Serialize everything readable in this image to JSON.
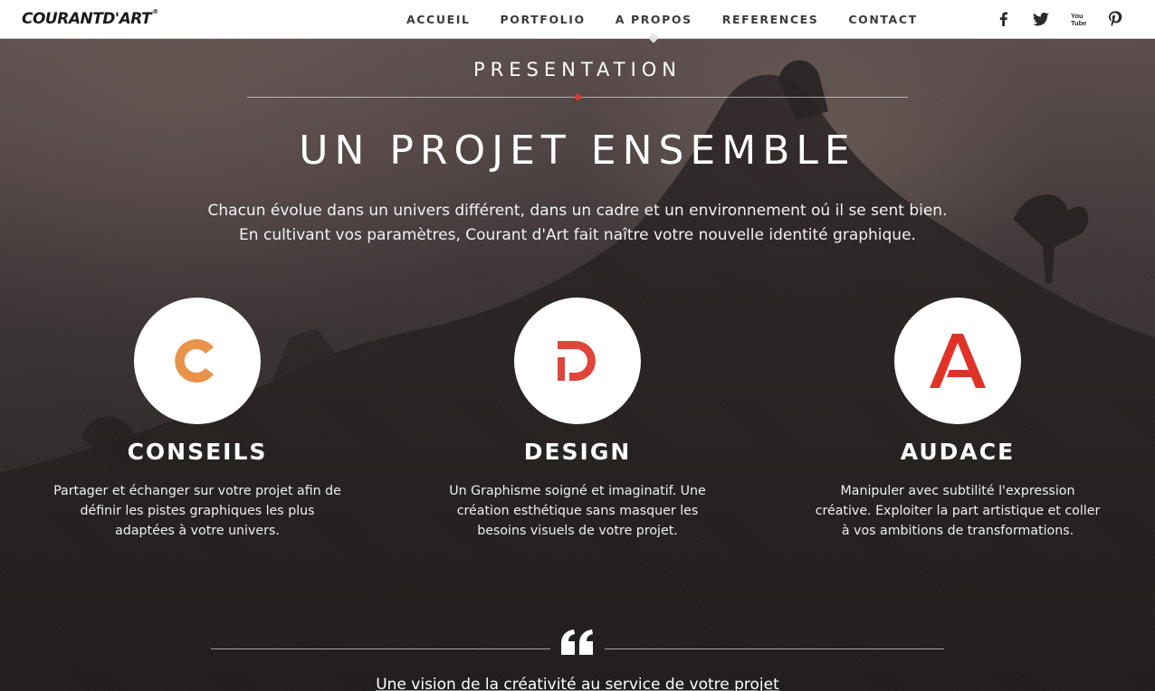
{
  "header": {
    "logo_text": "COURANTD'ART",
    "logo_mark": "®",
    "nav": [
      {
        "label": "ACCUEIL"
      },
      {
        "label": "PORTFOLIO"
      },
      {
        "label": "A PROPOS"
      },
      {
        "label": "REFERENCES"
      },
      {
        "label": "CONTACT"
      }
    ],
    "active_nav": "A PROPOS",
    "social": [
      "facebook-icon",
      "twitter-icon",
      "youtube-icon",
      "pinterest-icon"
    ]
  },
  "presentation": {
    "section_title": "PRESENTATION",
    "headline": "UN PROJET ENSEMBLE",
    "intro_line_1": "Chacun évolue dans un univers différent, dans un cadre et un environnement oú il se sent bien.",
    "intro_line_2": "En cultivant vos paramètres, Courant d'Art fait naître votre nouvelle identité graphique."
  },
  "features": [
    {
      "letter": "C",
      "title": "CONSEILS",
      "description": "Partager et échanger sur votre projet afin de définir les pistes graphiques les plus adaptées à votre univers.",
      "color": "#e8924a"
    },
    {
      "letter": "D",
      "title": "DESIGN",
      "description": "Un Graphisme soigné et imaginatif. Une création esthétique sans masquer les besoins visuels de votre projet.",
      "color": "#e0453a"
    },
    {
      "letter": "A",
      "title": "AUDACE",
      "description": "Manipuler avec subtilité l'expression créative. Exploiter la part artistique et coller à vos ambitions de transformations.",
      "color": "#e03328"
    }
  ],
  "quote": {
    "text": "Une vision de la créativité au service de votre projet"
  },
  "colors": {
    "accent_red": "#e0352b",
    "header_bg": "#ffffff"
  }
}
